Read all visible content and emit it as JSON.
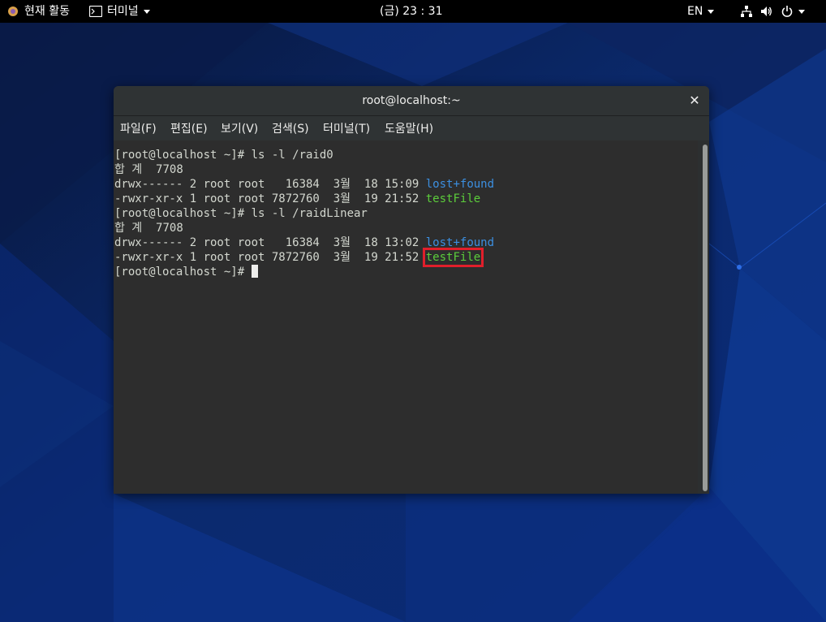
{
  "topbar": {
    "activities": "현재 활동",
    "app_menu": "터미널",
    "clock": "(금) 23 : 31",
    "language": "EN"
  },
  "window": {
    "title": "root@localhost:~"
  },
  "menu": [
    "파일(F)",
    "편집(E)",
    "보기(V)",
    "검색(S)",
    "터미널(T)",
    "도움말(H)"
  ],
  "terminal": {
    "lines": [
      {
        "text": "[root@localhost ~]# ls -l /raid0"
      },
      {
        "text": "합 계  7708"
      },
      {
        "text": "drwx------ 2 root root   16384  3월  18 15:09 ",
        "name": "lost+found",
        "color": "blue"
      },
      {
        "text": "-rwxr-xr-x 1 root root 7872760  3월  19 21:52 ",
        "name": "testFile",
        "color": "green"
      },
      {
        "text": "[root@localhost ~]# ls -l /raidLinear"
      },
      {
        "text": "합 계  7708"
      },
      {
        "text": "drwx------ 2 root root   16384  3월  18 13:02 ",
        "name": "lost+found",
        "color": "blue"
      },
      {
        "text": "-rwxr-xr-x 1 root root 7872760  3월  19 21:52 ",
        "name": "testFile",
        "color": "green",
        "highlight": true
      },
      {
        "text": "[root@localhost ~]# ",
        "cursor": true
      }
    ]
  },
  "colors": {
    "dir": "#3c8fe0",
    "exec": "#5ccd3b",
    "highlight_box": "#e01f2b"
  }
}
